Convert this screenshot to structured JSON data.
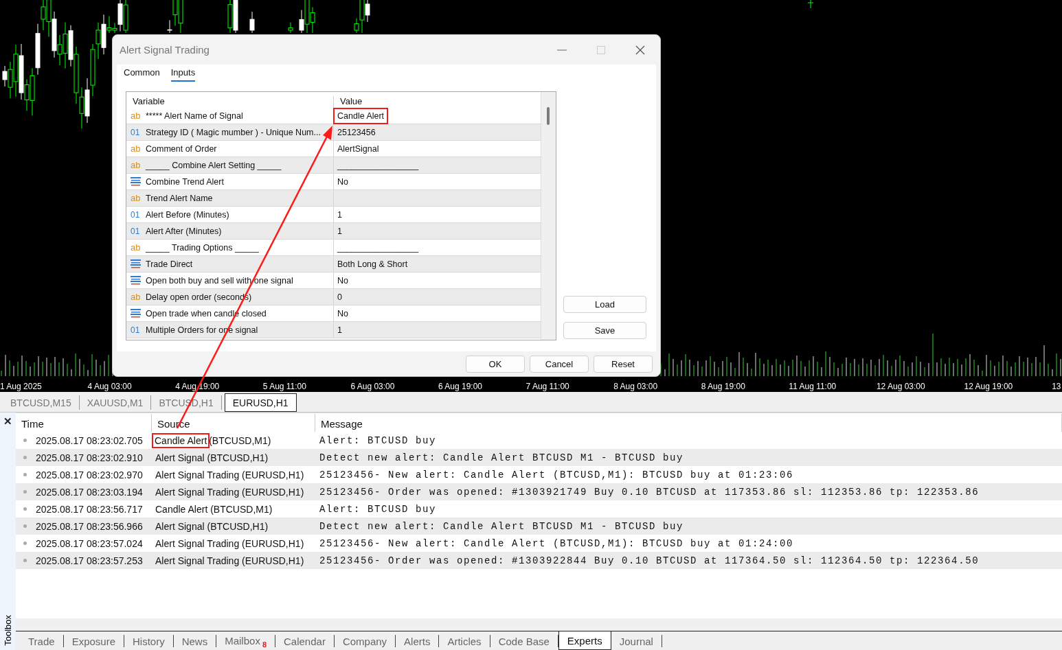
{
  "chart": {
    "x_labels": [
      "1 Aug 2025",
      "4 Aug 03:00",
      "4 Aug 19:00",
      "5 Aug 11:00",
      "6 Aug 03:00",
      "6 Aug 19:00",
      "7 Aug 11:00",
      "8 Aug 03:00",
      "8 Aug 19:00",
      "11 Aug 11:00",
      "12 Aug 03:00",
      "12 Aug 19:00",
      "13"
    ],
    "symbol_tabs": [
      {
        "label": "BTCUSD,M15",
        "selected": false
      },
      {
        "label": "XAUUSD,M1",
        "selected": false
      },
      {
        "label": "BTCUSD,H1",
        "selected": false
      },
      {
        "label": "EURUSD,H1",
        "selected": true
      }
    ]
  },
  "dialog": {
    "title": "Alert Signal Trading",
    "tabs": [
      {
        "label": "Common",
        "selected": false
      },
      {
        "label": "Inputs",
        "selected": true
      }
    ],
    "columns": [
      "Variable",
      "Value"
    ],
    "rows": [
      {
        "kind": "string",
        "icon": "ab",
        "variable": "***** Alert Name of Signal",
        "value": "Candle Alert",
        "highlighted": true
      },
      {
        "kind": "int",
        "icon": "01",
        "variable": "Strategy ID ( Magic mumber ) - Unique Num...",
        "value": "25123456",
        "highlighted": false
      },
      {
        "kind": "string",
        "icon": "ab",
        "variable": "Comment of Order",
        "value": "AlertSignal",
        "highlighted": false
      },
      {
        "kind": "string",
        "icon": "ab",
        "variable": "_____ Combine Alert Setting _____",
        "value": "_________________",
        "highlighted": false
      },
      {
        "kind": "enum",
        "variable": "Combine Trend Alert",
        "value": "No",
        "highlighted": false
      },
      {
        "kind": "string",
        "icon": "ab",
        "variable": "Trend Alert Name",
        "highlighted": false
      },
      {
        "kind": "int",
        "icon": "01",
        "variable": "Alert Before (Minutes)",
        "value": "1",
        "highlighted": false
      },
      {
        "kind": "int",
        "icon": "01",
        "variable": "Alert After (Minutes)",
        "value": "1",
        "highlighted": false
      },
      {
        "kind": "string",
        "icon": "ab",
        "variable": "_____ Trading Options _____",
        "value": "_________________",
        "highlighted": false
      },
      {
        "kind": "enum",
        "variable": "Trade Direct",
        "value": "Both Long & Short",
        "highlighted": false
      },
      {
        "kind": "enum",
        "variable": "Open both buy and sell with one signal",
        "value": "No",
        "highlighted": false
      },
      {
        "kind": "string",
        "icon": "ab",
        "variable": "Delay open order (seconds)",
        "value": "0",
        "highlighted": false
      },
      {
        "kind": "enum",
        "variable": "Open trade when candle closed",
        "value": "No",
        "highlighted": false
      },
      {
        "kind": "int",
        "icon": "01",
        "variable": "Multiple Orders for one signal",
        "value": "1",
        "highlighted": false
      }
    ],
    "side_buttons": [
      "Load",
      "Save"
    ],
    "buttons": [
      "OK",
      "Cancel",
      "Reset"
    ]
  },
  "toolbox": {
    "title": "Toolbox",
    "close": "✕",
    "columns": [
      "Time",
      "Source",
      "Message"
    ],
    "rows": [
      {
        "time": "2025.08.17 08:23:02.705",
        "source_name": "Candle Alert",
        "source_symbol": "(BTCUSD,M1)",
        "message": "Alert: BTCUSD buy",
        "highlighted": true
      },
      {
        "time": "2025.08.17 08:23:02.910",
        "source_name": "Alert Signal",
        "source_symbol": "(BTCUSD,H1)",
        "message": "Detect new alert: Candle Alert BTCUSD M1 - BTCUSD buy",
        "highlighted": false
      },
      {
        "time": "2025.08.17 08:23:02.970",
        "source_name": "Alert Signal Trading",
        "source_symbol": "(EURUSD,H1)",
        "message": "25123456- New alert: Candle Alert (BTCUSD,M1): BTCUSD buy at 01:23:06",
        "highlighted": false
      },
      {
        "time": "2025.08.17 08:23:03.194",
        "source_name": "Alert Signal Trading",
        "source_symbol": "(EURUSD,H1)",
        "message": "25123456- Order was opened: #1303921749 Buy 0.10 BTCUSD at 117353.86 sl: 112353.86 tp: 122353.86",
        "highlighted": false
      },
      {
        "time": "2025.08.17 08:23:56.717",
        "source_name": "Candle Alert",
        "source_symbol": "(BTCUSD,M1)",
        "message": "Alert: BTCUSD buy",
        "highlighted": false
      },
      {
        "time": "2025.08.17 08:23:56.966",
        "source_name": "Alert Signal",
        "source_symbol": "(BTCUSD,H1)",
        "message": "Detect new alert: Candle Alert BTCUSD M1 - BTCUSD buy",
        "highlighted": false
      },
      {
        "time": "2025.08.17 08:23:57.024",
        "source_name": "Alert Signal Trading",
        "source_symbol": "(EURUSD,H1)",
        "message": "25123456- New alert: Candle Alert (BTCUSD,M1): BTCUSD buy at 01:24:00",
        "highlighted": false
      },
      {
        "time": "2025.08.17 08:23:57.253",
        "source_name": "Alert Signal Trading",
        "source_symbol": "(EURUSD,H1)",
        "message": "25123456- Order was opened: #1303922844 Buy 0.10 BTCUSD at 117364.50 sl: 112364.50 tp: 122364.50",
        "highlighted": false
      }
    ],
    "tabs": [
      {
        "label": "Trade",
        "selected": false
      },
      {
        "label": "Exposure",
        "selected": false
      },
      {
        "label": "History",
        "selected": false
      },
      {
        "label": "News",
        "selected": false
      },
      {
        "label": "Mailbox",
        "badge": "8",
        "selected": false
      },
      {
        "label": "Calendar",
        "selected": false
      },
      {
        "label": "Company",
        "selected": false
      },
      {
        "label": "Alerts",
        "selected": false
      },
      {
        "label": "Articles",
        "selected": false
      },
      {
        "label": "Code Base",
        "selected": false
      },
      {
        "label": "Experts",
        "selected": true
      },
      {
        "label": "Journal",
        "selected": false
      }
    ]
  },
  "annotation_arrow": true
}
